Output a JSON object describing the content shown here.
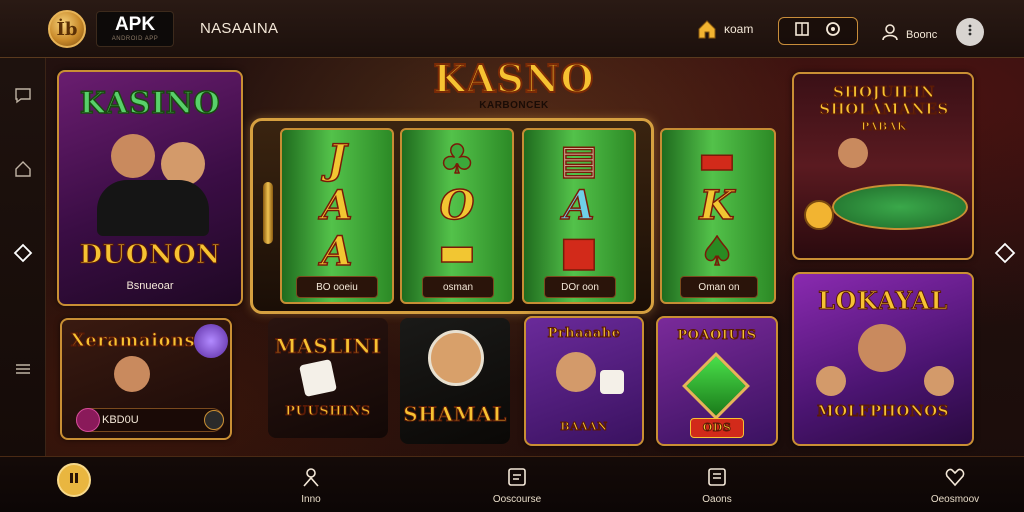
{
  "header": {
    "logo_glyph": "İb",
    "apk_title": "APK",
    "apk_subtitle": "ANDROID APP",
    "brand_name": "NASAAINA",
    "home_label": "ᴋoam",
    "profile_label": "Boonc"
  },
  "hero": {
    "title": "KASNO",
    "subtitle": "KARBONCEK"
  },
  "reels": [
    {
      "top": "J",
      "mid": "A",
      "bot": "A",
      "label": "BO ooeiu"
    },
    {
      "top": "♣",
      "mid": "O",
      "bot": "▬",
      "label": "osman"
    },
    {
      "top": "▤",
      "mid": "A",
      "bot": "■",
      "label": "DOr oon"
    },
    {
      "top": "▬",
      "mid": "K",
      "bot": "♠",
      "label": "Oman on"
    }
  ],
  "tiles": {
    "kasino_top": "KASINO",
    "kasino_title": "DUONON",
    "kasino_label": "Bsnueoar",
    "table_title": "SHOJUIEIN SHOLAMANES",
    "table_sub": "PABAK",
    "xeramaions_title": "Xeramaions",
    "xeramaions_label": "KBD0U",
    "maslini_title": "MASLINI",
    "maslini_sub": "PUUSHINS",
    "shamal_title": "SHAMAL",
    "purple1_title": "Prhaaahe",
    "purple1_label": "BAAAN",
    "purple2_title": "POAOIUIS",
    "purple2_label": "ODS",
    "lokayal_title": "LOKAYAL",
    "lokayal_label": "MOLFPHONOS"
  },
  "bottom_nav": [
    {
      "name": "home",
      "label": ""
    },
    {
      "name": "profile",
      "label": "Inno"
    },
    {
      "name": "games",
      "label": "Ooscourse"
    },
    {
      "name": "wallet",
      "label": "Oaons"
    },
    {
      "name": "favorites",
      "label": "Oeosmoov"
    }
  ],
  "colors": {
    "gold": "#d6a040",
    "reel_green": "#53c24a",
    "accent_purple": "#6a2a9a"
  }
}
